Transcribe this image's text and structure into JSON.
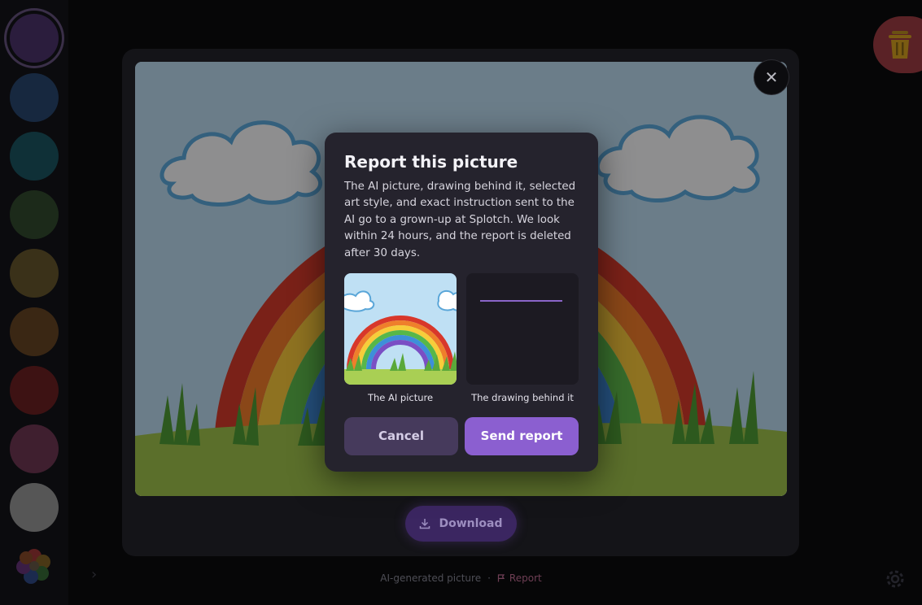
{
  "palette": {
    "colors": [
      "#2b1d3d",
      "#17283f",
      "#0f3037",
      "#1c2a1a",
      "#3a3119",
      "#3a2714",
      "#3d1213",
      "#3f1f2f",
      "#565656"
    ],
    "selected_index": 0
  },
  "viewer": {
    "download_label": "Download",
    "footer_text": "AI-generated picture",
    "footer_separator": "·",
    "report_label": "Report"
  },
  "modal": {
    "title": "Report this picture",
    "description": "The AI picture, drawing behind it, selected art style, and exact instruction sent to the AI go to a grown-up at Splotch. We look within 24 hours, and the report is deleted after 30 days.",
    "thumb_ai_caption": "The AI picture",
    "thumb_drawing_caption": "The drawing behind it",
    "cancel_label": "Cancel",
    "send_label": "Send report"
  },
  "colors": {
    "accent": "#8b5fd0",
    "modal_bg": "#25232d",
    "danger": "#5a2226"
  },
  "icons": {
    "close": "close-icon",
    "download": "download-icon",
    "flag": "flag-icon",
    "trash": "trash-icon",
    "gear": "gear-icon",
    "flower": "flower-palette-icon"
  }
}
